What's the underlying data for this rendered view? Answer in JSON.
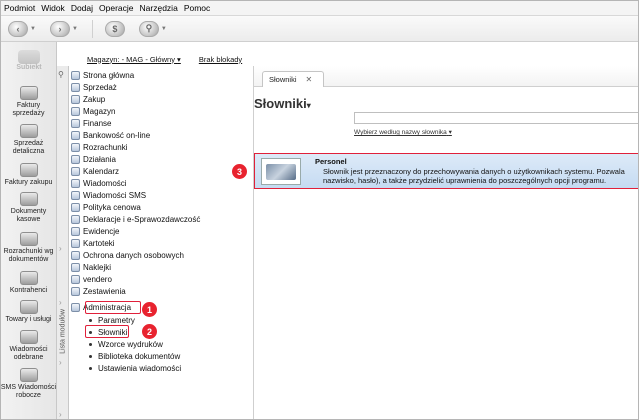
{
  "menubar": {
    "items": [
      "Podmiot",
      "Widok",
      "Dodaj",
      "Operacje",
      "Narzędzia",
      "Pomoc"
    ]
  },
  "toolbar": {
    "buttons": [
      "back-icon",
      "forward-icon",
      "refresh-icon",
      "search-icon"
    ]
  },
  "leftnav": {
    "logo": "Subiekt",
    "items": [
      "Faktury sprzedaży",
      "Sprzedaż detaliczna",
      "Faktury zakupu",
      "Dokumenty kasowe",
      "Rozrachunki wg dokumentów",
      "Kontrahenci",
      "Towary i usługi",
      "Wiadomości odebrane",
      "SMS Wiadomości robocze"
    ],
    "vertical_label": "Lista modułów"
  },
  "topbar": {
    "warehouse_link": "Magazyn: - MAG - Główny",
    "lock_link": "Brak blokady"
  },
  "tree": {
    "modules": [
      "Strona główna",
      "Sprzedaż",
      "Zakup",
      "Magazyn",
      "Finanse",
      "Bankowość on-line",
      "Rozrachunki",
      "Działania",
      "Kalendarz",
      "Wiadomości",
      "Wiadomości SMS",
      "Polityka cenowa",
      "Deklaracje i e-Sprawozdawczość",
      "Ewidencje",
      "Kartoteki",
      "Ochrona danych osobowych",
      "Naklejki",
      "vendero",
      "Zestawienia",
      "Administracja"
    ],
    "submodules": [
      "Parametry",
      "Słowniki",
      "Wzorce wydruków",
      "Biblioteka dokumentów",
      "Ustawienia wiadomości"
    ]
  },
  "main": {
    "tab_label": "Słowniki",
    "page_title": "Słowniki",
    "search_value": "",
    "filter_label": "Wybierz według nazwy słownika",
    "card": {
      "title": "Personel",
      "desc_line1": "Słownik jest przeznaczony do przechowywania danych o użytkownikach systemu. Pozwala",
      "desc_line2": "nazwisko, hasło), a także przydzielić uprawnienia do poszczególnych opcji programu."
    }
  },
  "annotations": {
    "badge1": "1",
    "badge2": "2",
    "badge3": "3"
  },
  "colors": {
    "highlight": "#e0203a",
    "badge": "#e8232f",
    "card_bg": "#d3e4f6"
  }
}
